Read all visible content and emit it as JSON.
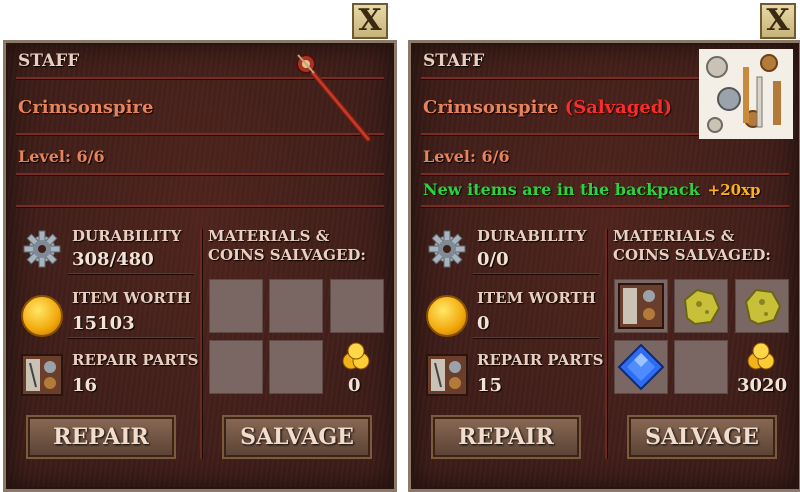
{
  "close_label": "X",
  "panels": [
    {
      "item_type": "STAFF",
      "item_name": "Crimsonspire",
      "item_suffix": "",
      "level": "Level: 6/6",
      "new_items": "",
      "xp": "",
      "durability_label": "DURABILITY",
      "durability_value": "308/480",
      "worth_label": "ITEM WORTH",
      "worth_value": "15103",
      "parts_label": "REPAIR PARTS",
      "parts_value": "16",
      "materials_title": "MATERIALS & COINS SALVAGED:",
      "coins_value": "0",
      "repair_label": "REPAIR",
      "salvage_label": "SALVAGE"
    },
    {
      "item_type": "STAFF",
      "item_name": "Crimsonspire",
      "item_suffix": "(Salvaged)",
      "level": "Level: 6/6",
      "new_items": "New items are in the backpack",
      "xp": "+20xp",
      "durability_label": "DURABILITY",
      "durability_value": "0/0",
      "worth_label": "ITEM WORTH",
      "worth_value": "0",
      "parts_label": "REPAIR PARTS",
      "parts_value": "15",
      "materials_title": "MATERIALS & COINS SALVAGED:",
      "coins_value": "3020",
      "repair_label": "REPAIR",
      "salvage_label": "SALVAGE",
      "salvaged_items": [
        "repair-parts-icon",
        "gold-ore-icon",
        "gold-ore-icon",
        "blue-gem-icon"
      ]
    }
  ]
}
